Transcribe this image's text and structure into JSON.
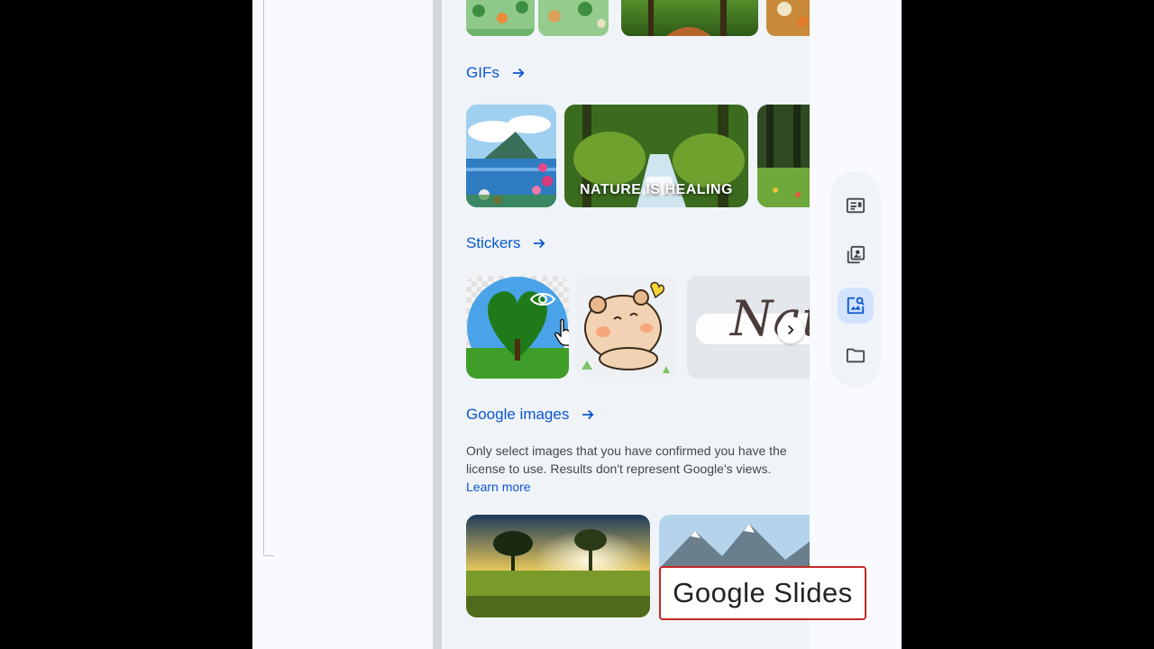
{
  "sections": {
    "gifs": {
      "label": "GIFs"
    },
    "stickers": {
      "label": "Stickers"
    },
    "google_images": {
      "label": "Google images"
    }
  },
  "gifs": [
    {
      "name": "lake-mountain-flowers"
    },
    {
      "name": "forest-stream",
      "overlay": "NATURE IS HEALING"
    },
    {
      "name": "forest-meadow"
    }
  ],
  "stickers": [
    {
      "name": "heart-tree"
    },
    {
      "name": "cartoon-bear"
    },
    {
      "name": "nature-handwriting",
      "text": "Nat"
    }
  ],
  "notice": {
    "text": "Only select images that you have confirmed you have the license to use. Results don't represent Google's views.",
    "link": "Learn more"
  },
  "side_rail": [
    {
      "icon": "text-layout-icon",
      "active": false
    },
    {
      "icon": "image-stack-icon",
      "active": false
    },
    {
      "icon": "image-search-icon",
      "active": true
    },
    {
      "icon": "folder-icon",
      "active": false
    }
  ],
  "caption": {
    "text": "Google Slides"
  },
  "colors": {
    "link": "#0b57d0",
    "panel_bg": "#f0f4f9",
    "caption_border": "#c62828"
  }
}
